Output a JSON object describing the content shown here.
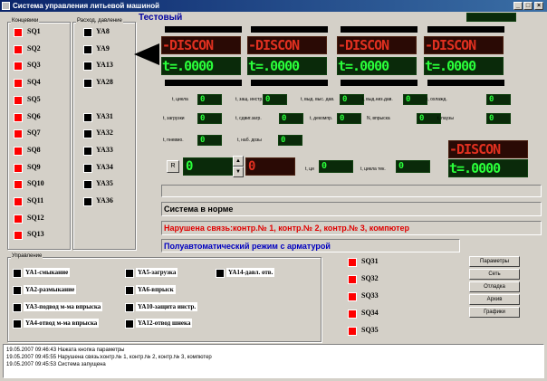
{
  "window": {
    "title": "Система управления литьевой машиной"
  },
  "header": {
    "machine_name": "Тестовый"
  },
  "limit_switches": {
    "label": "Концевики",
    "items": [
      "SQ1",
      "SQ2",
      "SQ3",
      "SQ4",
      "SQ5",
      "SQ6",
      "SQ7",
      "SQ8",
      "SQ9",
      "SQ10",
      "SQ11",
      "SQ12",
      "SQ13"
    ],
    "states": [
      "red",
      "red",
      "red",
      "red",
      "red",
      "red",
      "red",
      "red",
      "red",
      "red",
      "red",
      "red",
      "red"
    ]
  },
  "flow_pressure": {
    "label": "Расход, давление",
    "items": [
      "YA8",
      "YA9",
      "YA13",
      "YA28",
      "YA31",
      "YA32",
      "YA33",
      "YA34",
      "YA35",
      "YA36"
    ]
  },
  "displays": {
    "red_text": "-DISCON",
    "green_text": "t=.0000"
  },
  "params": [
    {
      "label": "t, цикла",
      "value": "0"
    },
    {
      "label": "t, защ. инстр.",
      "value": "0"
    },
    {
      "label": "t, выд. выс. дав.",
      "value": "0"
    },
    {
      "label": "t, выд.низ.дав.",
      "value": "0"
    },
    {
      "label": "t, охлажд.",
      "value": "0"
    },
    {
      "label": "t, загрузки",
      "value": "0"
    },
    {
      "label": "t, сдвиг.загр.",
      "value": "0"
    },
    {
      "label": "t, декомпр.",
      "value": "0"
    },
    {
      "label": "N, впрыска",
      "value": "0"
    },
    {
      "label": "t, паузы",
      "value": "0"
    },
    {
      "label": "t, пневмо.",
      "value": "0"
    },
    {
      "label": "t, наб. дозы",
      "value": "0"
    }
  ],
  "counters": {
    "r_button": "R",
    "counter_green": "0",
    "counter_red": "0",
    "t_ci_label": "t, ци",
    "t_ci_value": "0",
    "t_cycle_cur_label": "t, цикла тек.",
    "t_cycle_cur_value": "0"
  },
  "status": {
    "line1": "",
    "line2": "Система в норме",
    "line3": "Нарушена связь:контр.№ 1, контр.№ 2, контр.№ 3, компютер",
    "line4": "Полуавтоматический режим с арматурой"
  },
  "control": {
    "label": "Управление",
    "col1": [
      "YA1-смыкание",
      "YA2-размыкание",
      "YA3-подвод м-ма впрыска",
      "YA4-отвод м-ма впрыска"
    ],
    "col2": [
      "YA5-загрузка",
      "YA6-впрыск",
      "YA10-защита инстр.",
      "YA12-отвод шнека"
    ],
    "col3": [
      "YA14-давл. отв."
    ]
  },
  "sq_right": [
    "SQ31",
    "SQ32",
    "SQ33",
    "SQ34",
    "SQ35"
  ],
  "buttons": [
    "Параметры",
    "Сеть",
    "Отладка",
    "Архив",
    "Графики"
  ],
  "log": [
    "19.05.2007 09:46:43 Нажата кнопка параметры",
    "19.05.2007 09:45:55 Нарушена связь:контр.№ 1, контр.№ 2, контр.№ 3, компютер",
    "19.05.2007 09:45:53 Система запущена"
  ],
  "colors": {
    "indicator_on": "#ff0000",
    "indicator_off": "#000000",
    "status_error": "#e00000",
    "status_mode": "#0000c0"
  }
}
